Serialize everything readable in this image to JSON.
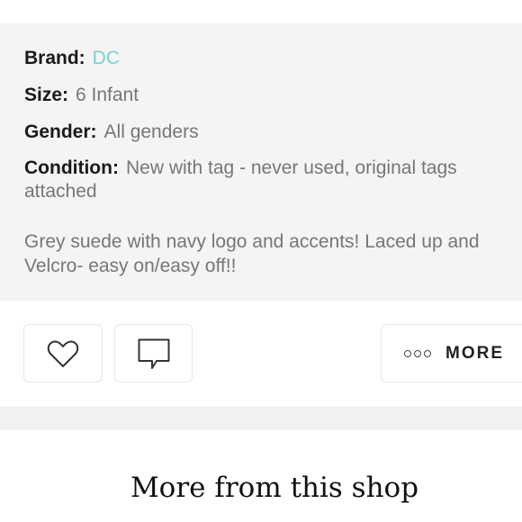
{
  "details": {
    "brand": {
      "label": "Brand:",
      "value": "DC"
    },
    "size": {
      "label": "Size:",
      "value": "6 Infant"
    },
    "gender": {
      "label": "Gender:",
      "value": "All genders"
    },
    "condition": {
      "label": "Condition:",
      "value": "New with tag - never used, original tags attached"
    },
    "description": "Grey suede with navy logo and accents! Laced up and Velcro- easy on/easy off!!"
  },
  "actions": {
    "like_icon": "heart-icon",
    "comment_icon": "comment-icon",
    "more_icon": "dots-icon",
    "more_label": "MORE"
  },
  "section": {
    "more_from_title": "More from this shop"
  },
  "colors": {
    "brand_link": "#7fcfcf",
    "details_bg": "#f4f4f4",
    "label_text": "#1a1a1a",
    "value_text": "#767676"
  }
}
